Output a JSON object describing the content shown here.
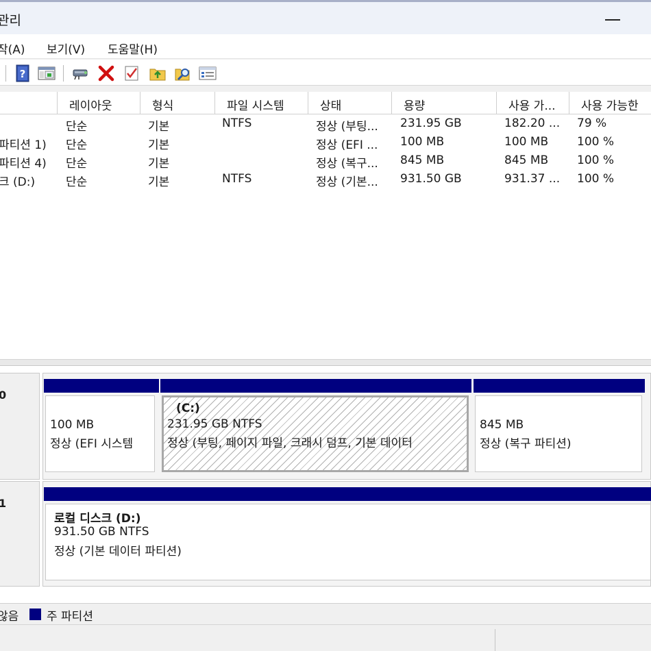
{
  "window": {
    "title": "관리"
  },
  "menubar": {
    "items": [
      "작(A)",
      "보기(V)",
      "도움말(H)"
    ]
  },
  "toolbar": {
    "icons": [
      "help-icon",
      "console-view-icon",
      "connect-disk-icon",
      "delete-icon",
      "check-icon",
      "up-folder-icon",
      "find-icon",
      "properties-icon"
    ]
  },
  "volume_list": {
    "columns": [
      "레이아웃",
      "형식",
      "파일 시스템",
      "상태",
      "용량",
      "사용 가...",
      "사용 가능한"
    ],
    "rows": [
      {
        "volume": "",
        "layout": "단순",
        "type": "기본",
        "fs": "NTFS",
        "status": "정상 (부팅...",
        "capacity": "231.95 GB",
        "free": "182.20 ...",
        "pct": "79 %"
      },
      {
        "volume": "파티션 1)",
        "layout": "단순",
        "type": "기본",
        "fs": "",
        "status": "정상 (EFI ...",
        "capacity": "100 MB",
        "free": "100 MB",
        "pct": "100 %"
      },
      {
        "volume": "파티션 4)",
        "layout": "단순",
        "type": "기본",
        "fs": "",
        "status": "정상 (복구...",
        "capacity": "845 MB",
        "free": "845 MB",
        "pct": "100 %"
      },
      {
        "volume": "크 (D:)",
        "layout": "단순",
        "type": "기본",
        "fs": "NTFS",
        "status": "정상 (기본...",
        "capacity": "931.50 GB",
        "free": "931.37 ...",
        "pct": "100 %"
      }
    ]
  },
  "disk_graph": {
    "disks": [
      {
        "label": "0",
        "partitions": [
          {
            "name": "",
            "size": "100 MB",
            "status": "정상 (EFI 시스템"
          },
          {
            "name": "(C:)",
            "size": "231.95 GB NTFS",
            "status": "정상 (부팅, 페이지 파일, 크래시 덤프, 기본 데이터"
          },
          {
            "name": "",
            "size": "845 MB",
            "status": "정상 (복구 파티션)"
          }
        ]
      },
      {
        "label": "1",
        "partitions": [
          {
            "name": "로컬 디스크  (D:)",
            "size": "931.50 GB NTFS",
            "status": "정상 (기본 데이터 파티션)"
          }
        ]
      }
    ]
  },
  "legend": {
    "unallocated_suffix": "않음",
    "primary_label": "주 파티션",
    "primary_color": "#000080"
  }
}
